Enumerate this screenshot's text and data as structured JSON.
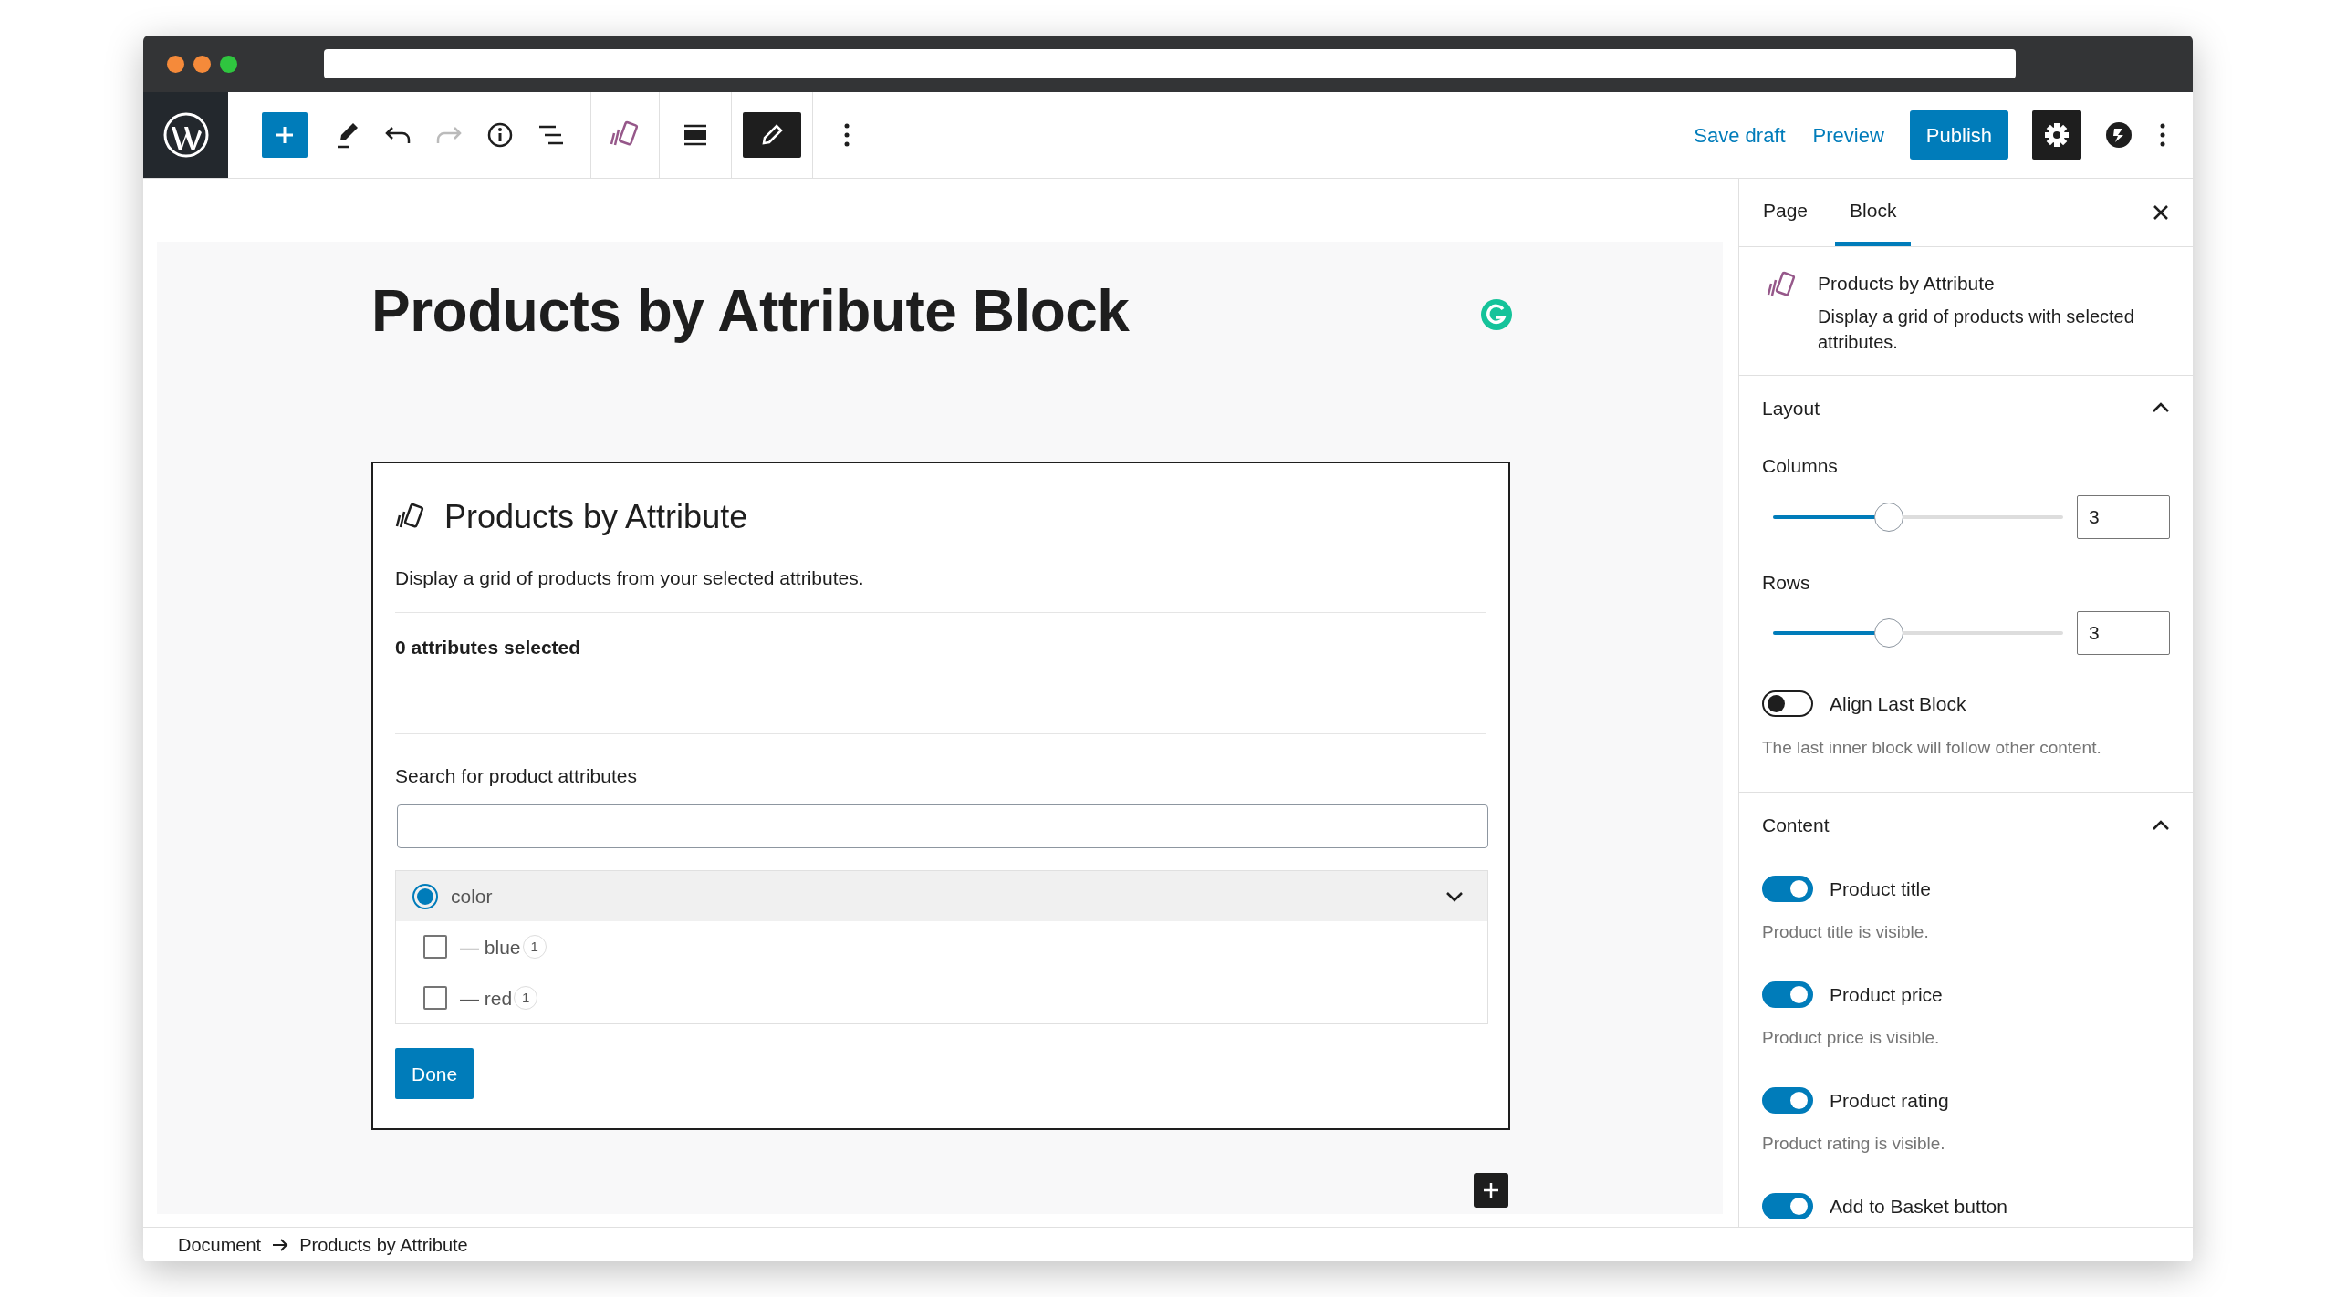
{
  "toolbar": {
    "actions": [
      {
        "label": "Save draft",
        "kind": "link"
      },
      {
        "label": "Preview",
        "kind": "link"
      },
      {
        "label": "Publish",
        "kind": "primary"
      }
    ]
  },
  "editor": {
    "title": "Products by Attribute Block",
    "block": {
      "heading": "Products by Attribute",
      "description": "Display a grid of products from your selected attributes.",
      "selected_count": "0 attributes selected",
      "search_label": "Search for product attributes",
      "attributes": [
        {
          "label": "color",
          "selected": true,
          "expanded": true,
          "children": [
            {
              "label": "— blue",
              "count": "1",
              "checked": false
            },
            {
              "label": "— red",
              "count": "1",
              "checked": false
            }
          ]
        }
      ],
      "done_button": "Done"
    }
  },
  "sidebar": {
    "tabs": [
      {
        "label": "Page",
        "selected": false
      },
      {
        "label": "Block",
        "selected": true
      }
    ],
    "block_card": {
      "title": "Products by Attribute",
      "description": "Display a grid of products with selected attributes."
    },
    "panels": [
      {
        "title": "Layout",
        "expanded": true,
        "controls": [
          {
            "kind": "slider",
            "label": "Columns",
            "level": 0.4,
            "value": "3"
          },
          {
            "kind": "slider",
            "label": "Rows",
            "level": 0.4,
            "value": "3"
          },
          {
            "kind": "toggle",
            "label": "Align Last Block",
            "on": false,
            "help": "The last inner block will follow other content."
          }
        ]
      },
      {
        "title": "Content",
        "expanded": true,
        "controls": [
          {
            "kind": "toggle",
            "label": "Product title",
            "on": true,
            "help": "Product title is visible."
          },
          {
            "kind": "toggle",
            "label": "Product price",
            "on": true,
            "help": "Product price is visible."
          },
          {
            "kind": "toggle",
            "label": "Product rating",
            "on": true,
            "help": "Product rating is visible."
          },
          {
            "kind": "toggle",
            "label": "Add to Basket button",
            "on": true
          }
        ]
      }
    ]
  },
  "breadcrumb": [
    "Document",
    "Products by Attribute"
  ]
}
